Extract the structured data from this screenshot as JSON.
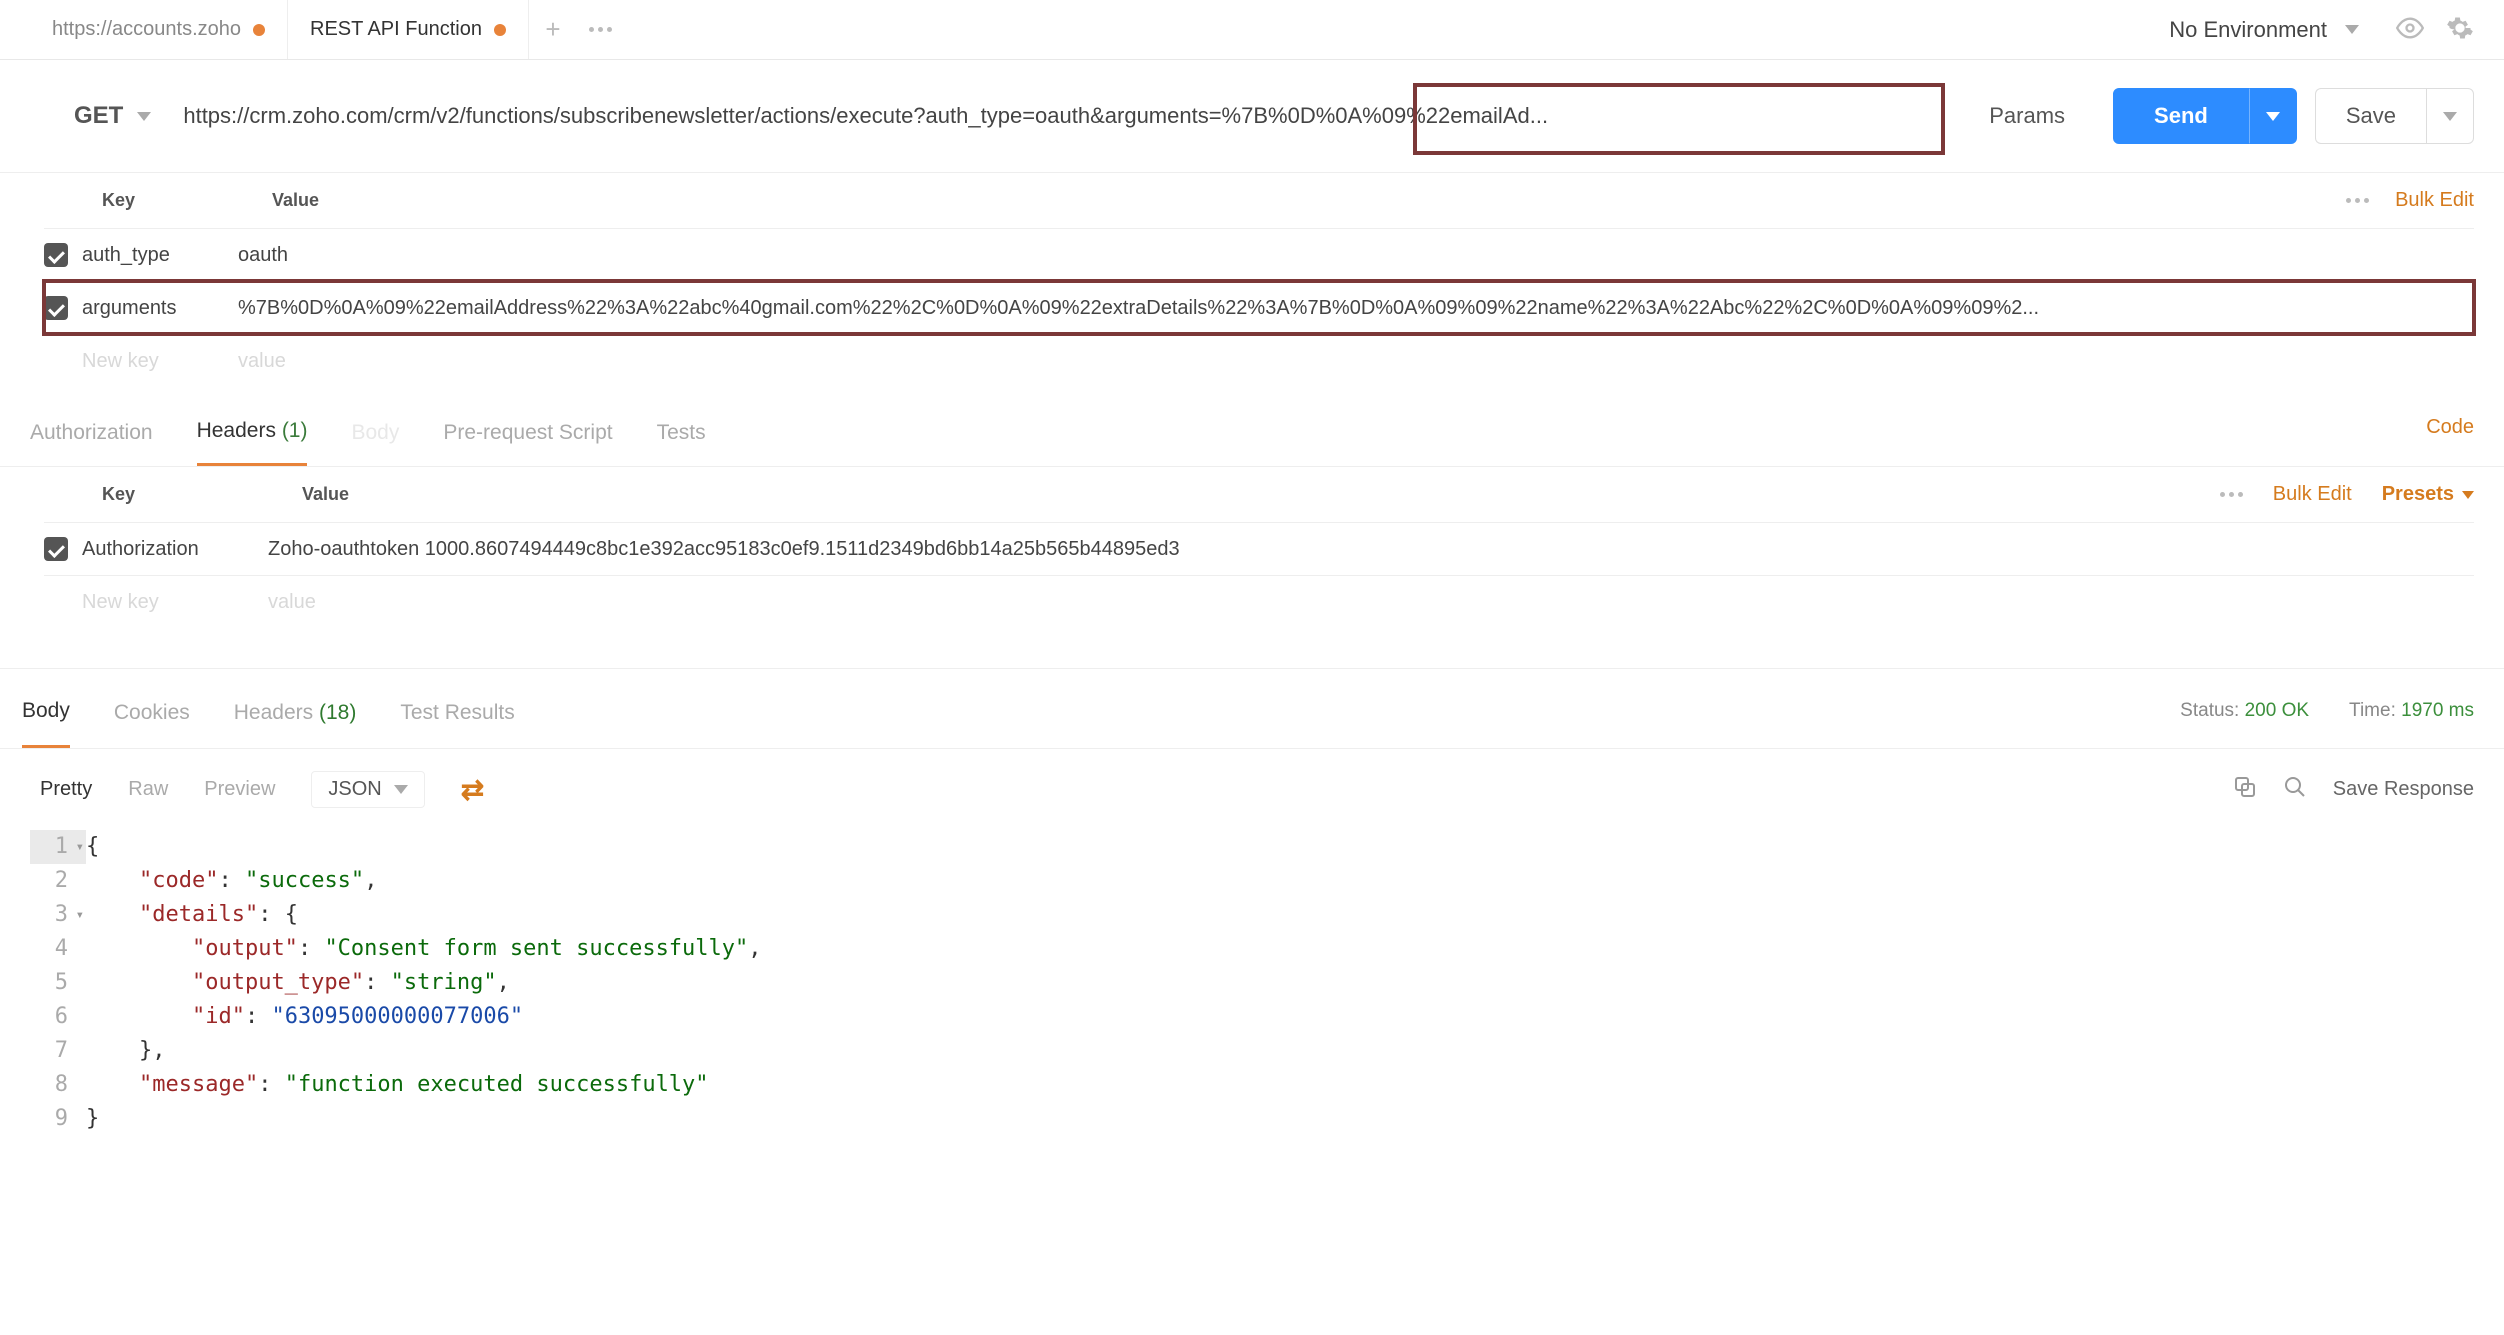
{
  "tabs": [
    {
      "label": "https://accounts.zoho",
      "dirty": true,
      "active": false
    },
    {
      "label": "REST API Function",
      "dirty": true,
      "active": true
    }
  ],
  "environment": "No Environment",
  "request": {
    "method": "GET",
    "url": "https://crm.zoho.com/crm/v2/functions/subscribenewsletter/actions/execute?auth_type=oauth&arguments=%7B%0D%0A%09%22emailAd...",
    "params_label": "Params",
    "send_label": "Send",
    "save_label": "Save"
  },
  "params_table": {
    "key_label": "Key",
    "value_label": "Value",
    "bulk_edit": "Bulk Edit",
    "rows": [
      {
        "key": "auth_type",
        "value": "oauth",
        "checked": true,
        "highlighted": false
      },
      {
        "key": "arguments",
        "value": "%7B%0D%0A%09%22emailAddress%22%3A%22abc%40gmail.com%22%2C%0D%0A%09%22extraDetails%22%3A%7B%0D%0A%09%09%22name%22%3A%22Abc%22%2C%0D%0A%09%09%2...",
        "checked": true,
        "highlighted": true
      }
    ],
    "placeholder": {
      "key": "New key",
      "value": "value"
    }
  },
  "request_tabs": {
    "items": [
      {
        "label": "Authorization",
        "active": false,
        "count": null
      },
      {
        "label": "Headers",
        "active": true,
        "count": "(1)"
      },
      {
        "label": "Body",
        "active": false,
        "count": null
      },
      {
        "label": "Pre-request Script",
        "active": false,
        "count": null
      },
      {
        "label": "Tests",
        "active": false,
        "count": null
      }
    ],
    "code_link": "Code"
  },
  "headers_table": {
    "key_label": "Key",
    "value_label": "Value",
    "bulk_edit": "Bulk Edit",
    "presets": "Presets",
    "rows": [
      {
        "key": "Authorization",
        "value": "Zoho-oauthtoken 1000.8607494449c8bc1e392acc95183c0ef9.1511d2349bd6bb14a25b565b44895ed3",
        "checked": true
      }
    ],
    "placeholder": {
      "key": "New key",
      "value": "value"
    }
  },
  "response_tabs": {
    "items": [
      {
        "label": "Body",
        "active": true,
        "count": null
      },
      {
        "label": "Cookies",
        "active": false,
        "count": null
      },
      {
        "label": "Headers",
        "active": false,
        "count": "(18)"
      },
      {
        "label": "Test Results",
        "active": false,
        "count": null
      }
    ],
    "status_label": "Status:",
    "status_value": "200 OK",
    "time_label": "Time:",
    "time_value": "1970 ms"
  },
  "body_toolbar": {
    "modes": [
      "Pretty",
      "Raw",
      "Preview"
    ],
    "active_mode": "Pretty",
    "language": "JSON",
    "save_response": "Save Response"
  },
  "response_body": {
    "lines": [
      "{",
      "    \"code\": \"success\",",
      "    \"details\": {",
      "        \"output\": \"Consent form sent successfully\",",
      "        \"output_type\": \"string\",",
      "        \"id\": \"63095000000077006\"",
      "    },",
      "    \"message\": \"function executed successfully\"",
      "}"
    ]
  },
  "chart_data": {
    "type": "table",
    "title": "API response JSON body",
    "rows": [
      {
        "key": "code",
        "value": "success"
      },
      {
        "key": "details.output",
        "value": "Consent form sent successfully"
      },
      {
        "key": "details.output_type",
        "value": "string"
      },
      {
        "key": "details.id",
        "value": "63095000000077006"
      },
      {
        "key": "message",
        "value": "function executed successfully"
      }
    ]
  }
}
